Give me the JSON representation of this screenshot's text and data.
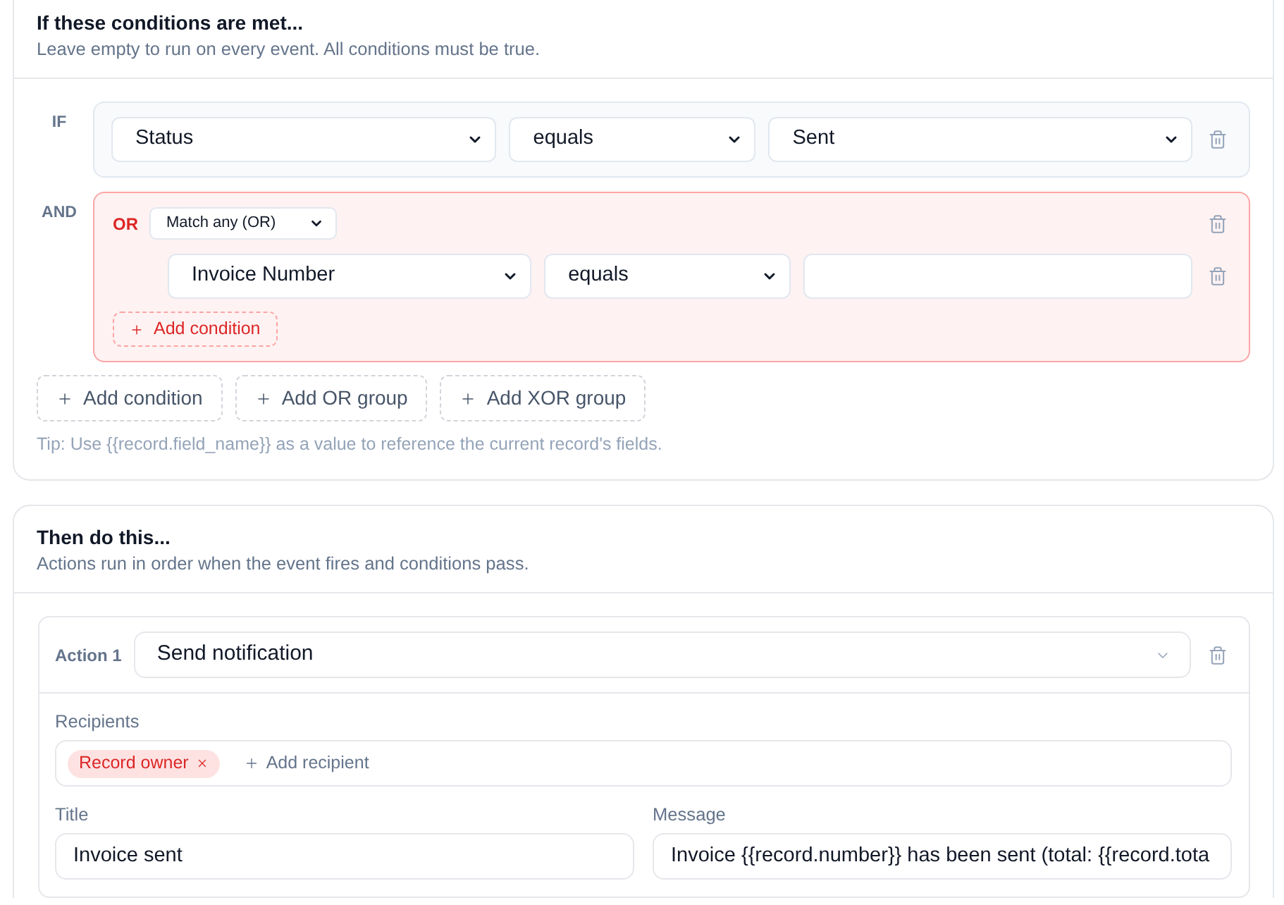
{
  "conditions_section": {
    "title": "If these conditions are met...",
    "description": "Leave empty to run on every event. All conditions must be true.",
    "rules": [
      {
        "kind": "condition",
        "connector": "IF",
        "field": "Status",
        "operator": "equals",
        "value": {
          "kind": "select",
          "text": "Sent"
        }
      },
      {
        "kind": "group",
        "connector": "AND",
        "group_type": "OR",
        "match": "Match any (OR)",
        "conditions": [
          {
            "field": "Invoice Number",
            "operator": "equals",
            "value": {
              "kind": "text"
            }
          }
        ],
        "add_condition": "Add condition"
      }
    ],
    "add_buttons": [
      "Add condition",
      "Add OR group",
      "Add XOR group"
    ],
    "tip": "Tip: Use {{record.field_name}} as a value to reference the current record's fields."
  },
  "actions_section": {
    "title": "Then do this...",
    "description": "Actions run in order when the event fires and conditions pass.",
    "actions": [
      {
        "label": "Action 1",
        "type": "Send notification",
        "recipients": {
          "label": "Recipients",
          "chips": [
            "Record owner"
          ],
          "add_label": "Add recipient"
        },
        "fields": [
          {
            "label": "Title",
            "value": "Invoice sent"
          },
          {
            "label": "Message",
            "value": "Invoice {{record.number}} has been sent (total: {{record.tota"
          }
        ]
      }
    ]
  }
}
